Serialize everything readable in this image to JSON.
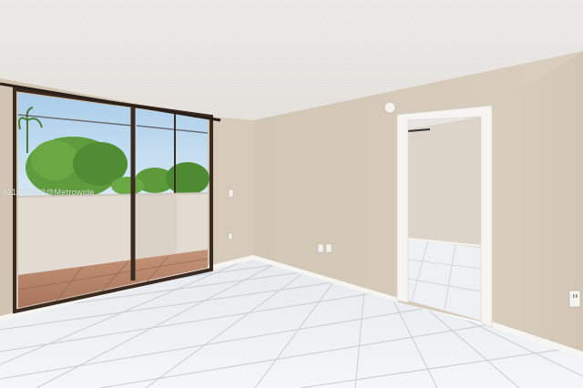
{
  "photo": {
    "watermark_text": "A11870982@Metrowide"
  },
  "colors": {
    "ceiling": "#e9e6e2",
    "wall_left": "#d3c8b6",
    "wall_back": "#d6cbbb",
    "wall_right": "#d8ccbc",
    "floor_tile": "#eef1f3",
    "grout": "#c9cfd4",
    "baseboard": "#f7f6f3",
    "door_trim": "#f5f4f1",
    "window_frame": "#3a2a20",
    "sky": "#bcd9ef",
    "foliage": "#5c9a3c",
    "balcony_wall": "#e3ddd4",
    "balcony_floor": "#b88468"
  }
}
